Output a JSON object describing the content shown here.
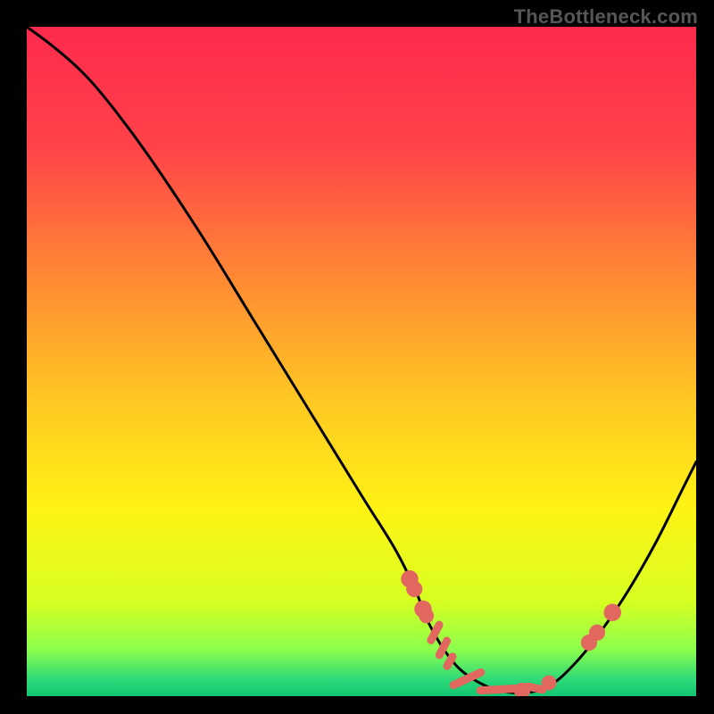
{
  "watermark": "TheBottleneck.com",
  "chart_data": {
    "type": "line",
    "title": "",
    "xlabel": "",
    "ylabel": "",
    "xlim": [
      0,
      100
    ],
    "ylim": [
      0,
      100
    ],
    "grid": false,
    "legend": false,
    "background_gradient": {
      "stops": [
        {
          "offset": 0.0,
          "color": "#ff2a4d"
        },
        {
          "offset": 0.18,
          "color": "#ff4349"
        },
        {
          "offset": 0.38,
          "color": "#ff8b33"
        },
        {
          "offset": 0.55,
          "color": "#ffc524"
        },
        {
          "offset": 0.72,
          "color": "#fff314"
        },
        {
          "offset": 0.86,
          "color": "#d6ff22"
        },
        {
          "offset": 0.93,
          "color": "#8cff4c"
        },
        {
          "offset": 0.975,
          "color": "#2dd978"
        },
        {
          "offset": 1.0,
          "color": "#13c574"
        }
      ]
    },
    "series": [
      {
        "name": "bottleneck-curve",
        "color": "#000000",
        "x": [
          0,
          4,
          8,
          12,
          18,
          26,
          34,
          42,
          50,
          55,
          58,
          60,
          63,
          66,
          70,
          74,
          78,
          82,
          86,
          90,
          94,
          98,
          100
        ],
        "y": [
          100,
          97,
          93.5,
          89,
          81,
          69,
          56,
          43,
          30,
          22,
          16,
          11,
          6,
          3,
          1,
          0.5,
          1.5,
          5,
          10,
          16,
          23,
          31,
          35
        ]
      }
    ],
    "markers": [
      {
        "name": "marker-dot",
        "x": 57.2,
        "y": 17.5,
        "r": 1.0
      },
      {
        "name": "marker-dot",
        "x": 57.9,
        "y": 16.0,
        "r": 0.9
      },
      {
        "name": "marker-dot",
        "x": 59.2,
        "y": 13.0,
        "r": 1.0
      },
      {
        "name": "marker-dot",
        "x": 59.7,
        "y": 12.0,
        "r": 0.8
      },
      {
        "name": "marker-dash",
        "x": 61.0,
        "y": 9.5,
        "len": 2.6,
        "angle": -62
      },
      {
        "name": "marker-dash",
        "x": 62.2,
        "y": 7.2,
        "len": 2.4,
        "angle": -62
      },
      {
        "name": "marker-dash",
        "x": 63.2,
        "y": 5.2,
        "len": 1.6,
        "angle": -60
      },
      {
        "name": "marker-dash",
        "x": 65.8,
        "y": 2.6,
        "len": 4.5,
        "angle": -25
      },
      {
        "name": "marker-dash",
        "x": 70.5,
        "y": 1.0,
        "len": 5.5,
        "angle": -3
      },
      {
        "name": "marker-dot",
        "x": 74.0,
        "y": 0.8,
        "r": 0.9
      },
      {
        "name": "marker-dash",
        "x": 76.0,
        "y": 1.2,
        "len": 2.2,
        "angle": 12
      },
      {
        "name": "marker-dot",
        "x": 78.0,
        "y": 2.0,
        "r": 0.8
      },
      {
        "name": "marker-dot",
        "x": 84.0,
        "y": 8.0,
        "r": 0.9
      },
      {
        "name": "marker-dot",
        "x": 85.2,
        "y": 9.5,
        "r": 0.9
      },
      {
        "name": "marker-dot",
        "x": 87.5,
        "y": 12.5,
        "r": 1.0
      }
    ]
  }
}
